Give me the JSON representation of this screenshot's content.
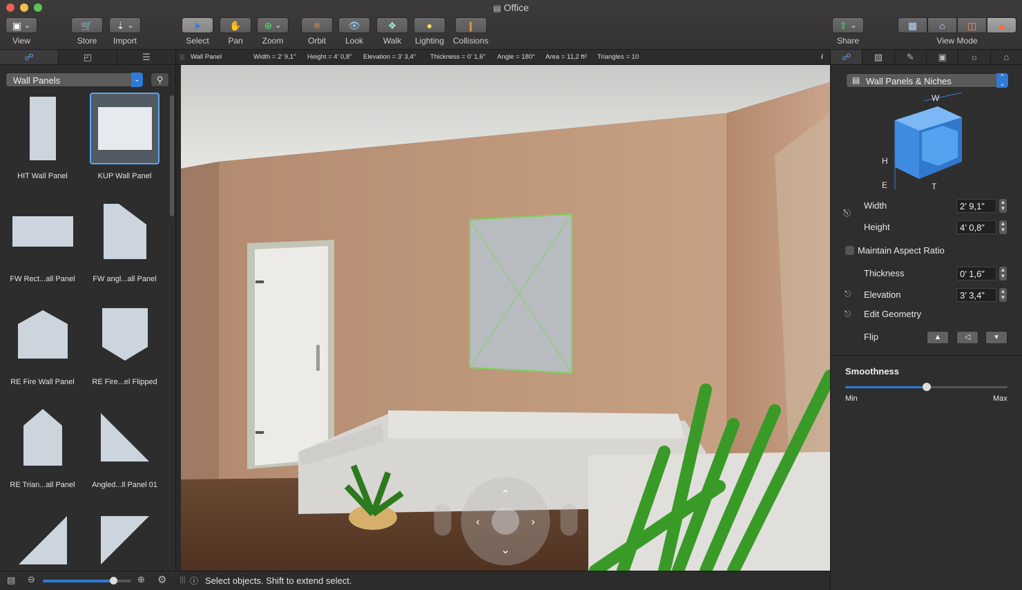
{
  "window": {
    "title": "Office"
  },
  "colors": {
    "accent": "#2f7ad6",
    "close": "#ec5f5a",
    "minimize": "#f4bf4f",
    "maximize": "#5ec454",
    "selection_green": "#7ed35a"
  },
  "toolbar": {
    "view": "View",
    "store": "Store",
    "import": "Import",
    "select": "Select",
    "pan": "Pan",
    "zoom": "Zoom",
    "orbit": "Orbit",
    "look": "Look",
    "walk": "Walk",
    "lighting": "Lighting",
    "collisions": "Collisions",
    "share": "Share",
    "view_mode": "View Mode"
  },
  "infobar": {
    "object": "Wall Panel",
    "width": "Width = 2’ 9,1”",
    "height": "Height = 4’ 0,8”",
    "elevation": "Elevation = 3’ 3,4”",
    "thickness": "Thickness = 0’ 1,6”",
    "angle": "Angle = 180°",
    "area": "Area = 11,2 ft²",
    "triangles": "Triangles = 10",
    "info": "i"
  },
  "library": {
    "category": "Wall Panels",
    "items": [
      {
        "label": "HIT Wall Panel"
      },
      {
        "label": "KUP Wall Panel"
      },
      {
        "label": "FW Rect...all Panel"
      },
      {
        "label": "FW angl...all Panel"
      },
      {
        "label": "RE Fire Wall Panel"
      },
      {
        "label": "RE Fire...el Flipped"
      },
      {
        "label": "RE Trian...all Panel"
      },
      {
        "label": "Angled...ll Panel 01"
      }
    ],
    "zoom_level": 0.8
  },
  "status": {
    "hint": "Select objects. Shift to extend select."
  },
  "inspector": {
    "category": "Wall Panels & Niches",
    "diagram": {
      "w": "W",
      "h": "H",
      "e": "E",
      "t": "T"
    },
    "width_label": "Width",
    "width_value": "2’ 9,1”",
    "height_label": "Height",
    "height_value": "4’ 0,8”",
    "aspect_label": "Maintain Aspect Ratio",
    "thickness_label": "Thickness",
    "thickness_value": "0’ 1,6”",
    "elevation_label": "Elevation",
    "elevation_value": "3’ 3,4”",
    "edit_geometry_label": "Edit Geometry",
    "flip_label": "Flip",
    "smoothness_label": "Smoothness",
    "smoothness_min": "Min",
    "smoothness_max": "Max",
    "smoothness_value": 0.5
  }
}
